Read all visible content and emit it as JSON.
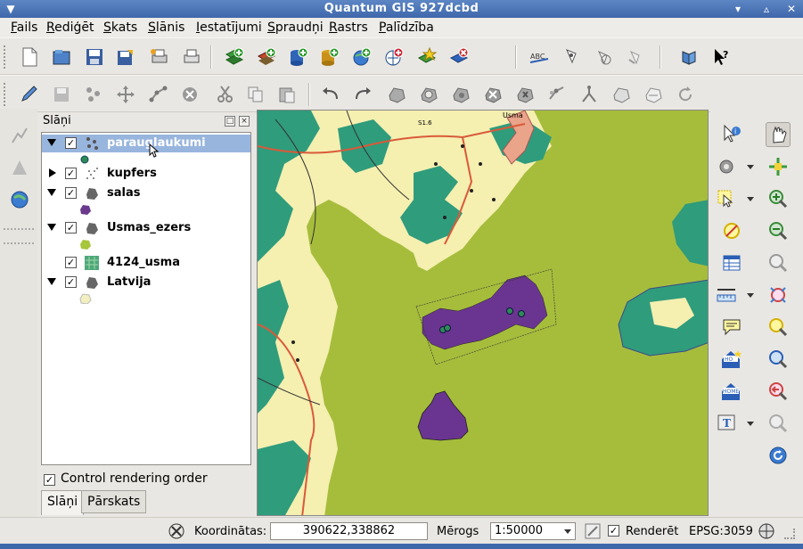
{
  "window": {
    "title": "Quantum GIS 927dcbd"
  },
  "menu": [
    "Fails",
    "Rediģēt",
    "Skats",
    "Slānis",
    "Iestatījumi",
    "Spraudņi",
    "Rastrs",
    "Palīdzība"
  ],
  "layers_panel": {
    "title": "Slāņi",
    "layers": [
      {
        "name": "paraugIaukumi",
        "expanded": true,
        "checked": true,
        "selected": true,
        "icon": "points-icon",
        "legend_color": "#2e8b57"
      },
      {
        "name": "kupfers",
        "expanded": false,
        "checked": true,
        "selected": false,
        "icon": "points-scatter-icon",
        "legend_color": ""
      },
      {
        "name": "salas",
        "expanded": true,
        "checked": true,
        "selected": false,
        "icon": "polygon-icon",
        "legend_color": "#6b3a8c"
      },
      {
        "name": "Usmas_ezers",
        "expanded": true,
        "checked": true,
        "selected": false,
        "icon": "polygon-icon",
        "legend_color": "#a7c63c"
      },
      {
        "name": "4124_usma",
        "expanded": false,
        "checked": true,
        "selected": false,
        "icon": "raster-icon",
        "legend_color": ""
      },
      {
        "name": "Latvija",
        "expanded": true,
        "checked": true,
        "selected": false,
        "icon": "polygon-icon",
        "legend_color": "#f2f0c0"
      }
    ],
    "control_rendering_order": {
      "label": "Control rendering order",
      "checked": true
    },
    "tabs": [
      "Slāņi",
      "Pārskats"
    ]
  },
  "map": {
    "labels": [
      "Usma",
      "S1.6"
    ],
    "colors": {
      "lake": "#a6bd3c",
      "forest": "#2f9c7c",
      "field": "#f5efb0",
      "island": "#6a3590"
    }
  },
  "statusbar": {
    "coords_label": "Koordinātas:",
    "coords_value": "390622,338862",
    "scale_label": "Mērogs",
    "scale_value": "1:50000",
    "render_label": "Renderēt",
    "render_checked": true,
    "crs": "EPSG:3059"
  }
}
